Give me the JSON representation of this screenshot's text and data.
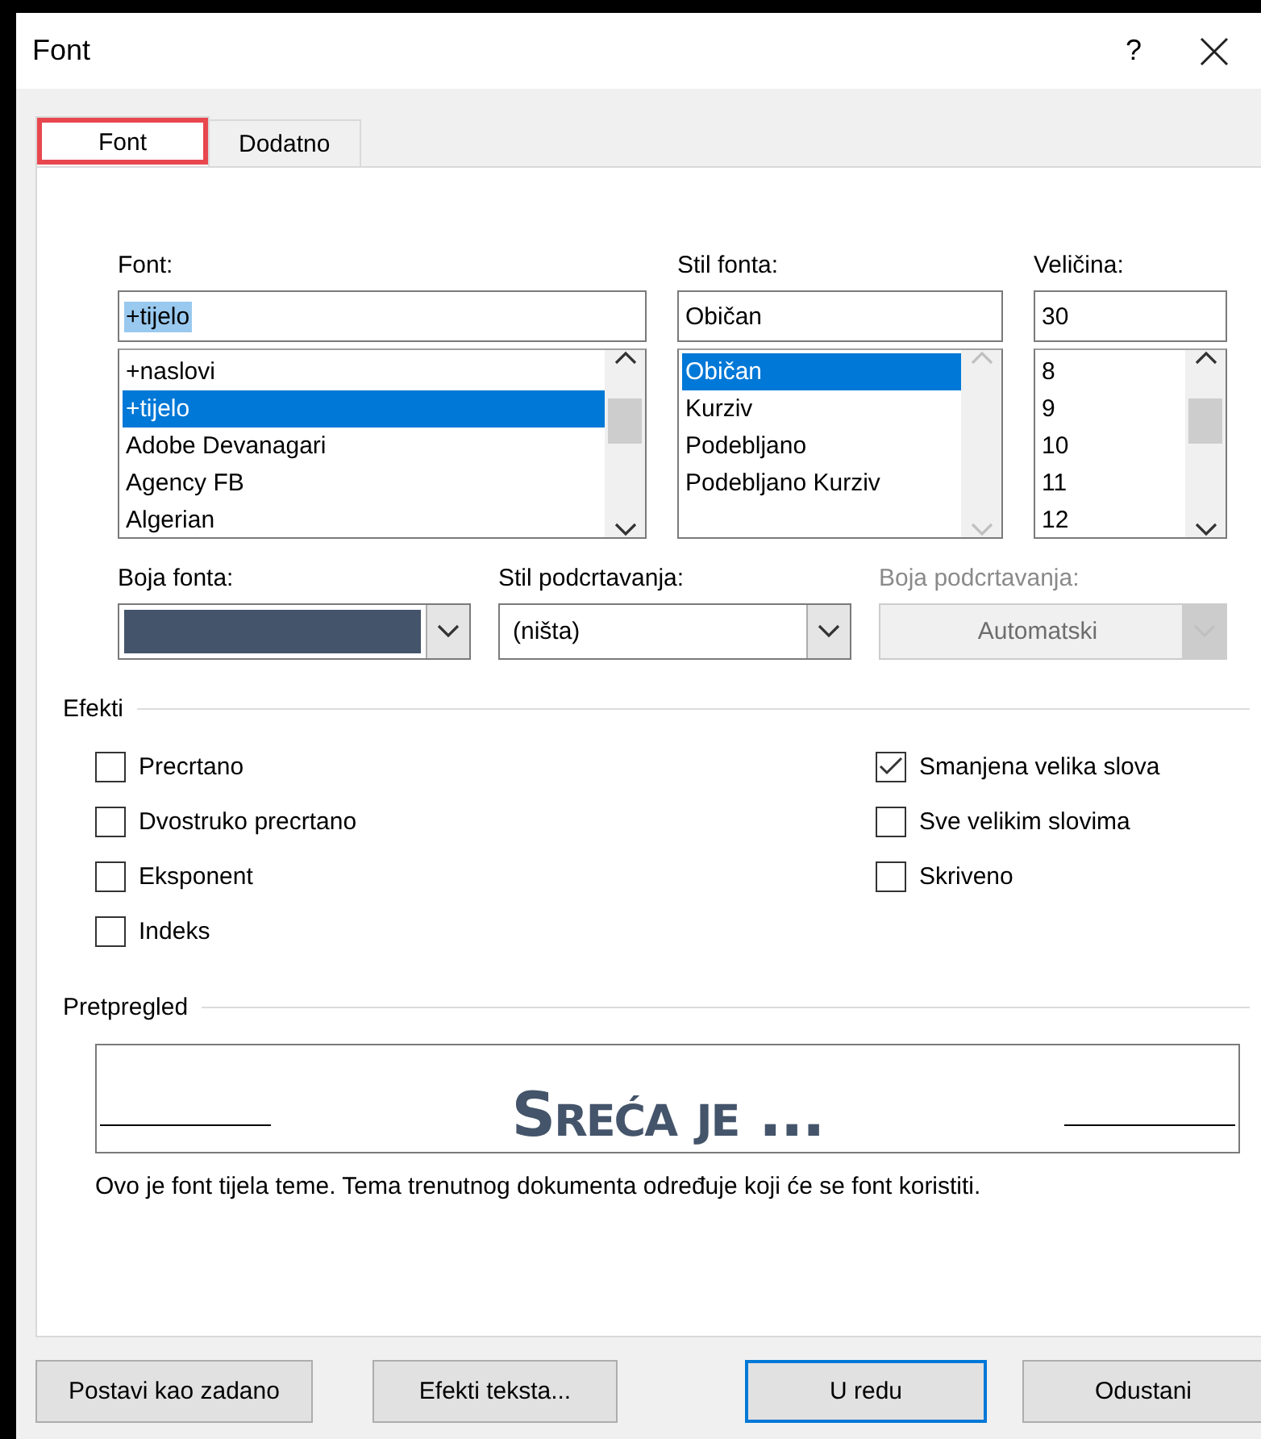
{
  "window": {
    "title": "Font",
    "help": "?"
  },
  "tabs": [
    {
      "label": "Font",
      "selected": true,
      "highlighted": true
    },
    {
      "label": "Dodatno",
      "selected": false,
      "highlighted": false
    }
  ],
  "font": {
    "label": "Font:",
    "value": "+tijelo",
    "items": [
      {
        "label": "+naslovi",
        "selected": false
      },
      {
        "label": "+tijelo",
        "selected": true
      },
      {
        "label": "Adobe Devanagari",
        "selected": false
      },
      {
        "label": "Agency FB",
        "selected": false
      },
      {
        "label": "Algerian",
        "selected": false
      }
    ]
  },
  "style": {
    "label": "Stil fonta:",
    "value": "Običan",
    "items": [
      {
        "label": "Običan",
        "selected": true
      },
      {
        "label": "Kurziv",
        "selected": false
      },
      {
        "label": "Podebljano",
        "selected": false
      },
      {
        "label": "Podebljano Kurziv",
        "selected": false
      }
    ]
  },
  "size": {
    "label": "Veličina:",
    "value": "30",
    "items": [
      {
        "label": "8",
        "selected": false
      },
      {
        "label": "9",
        "selected": false
      },
      {
        "label": "10",
        "selected": false
      },
      {
        "label": "11",
        "selected": false
      },
      {
        "label": "12",
        "selected": false
      }
    ]
  },
  "font_color": {
    "label": "Boja fonta:",
    "color": "#44546a"
  },
  "underline_style": {
    "label": "Stil podcrtavanja:",
    "value": "(ništa)",
    "disabled": false
  },
  "underline_color": {
    "label": "Boja podcrtavanja:",
    "value": "Automatski",
    "disabled": true
  },
  "effects": {
    "title": "Efekti",
    "left": [
      {
        "label": "Precrtano",
        "checked": false
      },
      {
        "label": "Dvostruko precrtano",
        "checked": false
      },
      {
        "label": "Eksponent",
        "checked": false
      },
      {
        "label": "Indeks",
        "checked": false
      }
    ],
    "right": [
      {
        "label": "Smanjena velika slova",
        "checked": true
      },
      {
        "label": "Sve velikim slovima",
        "checked": false
      },
      {
        "label": "Skriveno",
        "checked": false
      }
    ]
  },
  "preview": {
    "title": "Pretpregled",
    "sample": "Sreća je ...",
    "note": "Ovo je font tijela teme. Tema trenutnog dokumenta određuje koji će se font koristiti."
  },
  "buttons": [
    {
      "label": "Postavi kao zadano",
      "default": false
    },
    {
      "label": "Efekti teksta...",
      "default": false
    },
    {
      "label": "U redu",
      "default": true
    },
    {
      "label": "Odustani",
      "default": false
    }
  ]
}
